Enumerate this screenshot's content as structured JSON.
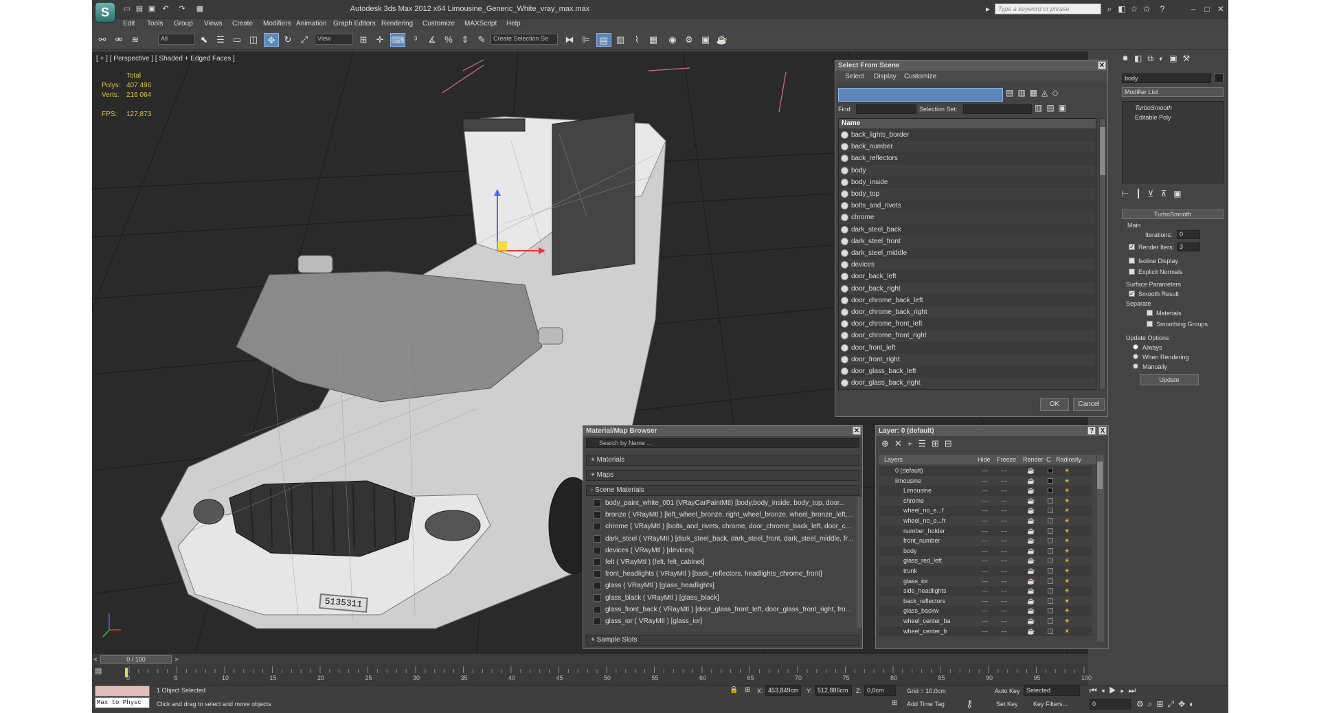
{
  "window": {
    "title": "Autodesk 3ds Max  2012 x64     Limousine_Generic_White_vray_max.max",
    "search_placeholder": "Type a keyword or phrase",
    "logo_glyph": "S"
  },
  "menu": [
    "Edit",
    "Tools",
    "Group",
    "Views",
    "Create",
    "Modifiers",
    "Animation",
    "Graph Editors",
    "Rendering",
    "Customize",
    "MAXScript",
    "Help"
  ],
  "toolbar": {
    "filter_value": "All",
    "refcoord_value": "View",
    "selection_set_placeholder": "Create Selection Se"
  },
  "viewport": {
    "label": "[ + ] [ Perspective ] [ Shaded + Edged Faces ]",
    "stats": {
      "total_label": "Total",
      "polys_label": "Polys:",
      "polys_value": "407 496",
      "verts_label": "Verts:",
      "verts_value": "216 064",
      "fps_label": "FPS:",
      "fps_value": "127,873"
    },
    "license_plate": "5135311"
  },
  "select_from_scene": {
    "title": "Select From Scene",
    "tabs": [
      "Select",
      "Display",
      "Customize"
    ],
    "find_label": "Find:",
    "selection_set_label": "Selection Set:",
    "column_name": "Name",
    "items": [
      "back_lights_border",
      "back_number",
      "back_reflectors",
      "body",
      "body_inside",
      "body_top",
      "bolts_and_rivets",
      "chrome",
      "dark_steel_back",
      "dark_steel_front",
      "dark_steel_middle",
      "devices",
      "door_back_left",
      "door_back_right",
      "door_chrome_back_left",
      "door_chrome_back_right",
      "door_chrome_front_left",
      "door_chrome_front_right",
      "door_front_left",
      "door_front_right",
      "door_glass_back_left",
      "door_glass_back_right"
    ],
    "ok_label": "OK",
    "cancel_label": "Cancel"
  },
  "material_browser": {
    "title": "Material/Map Browser",
    "search_placeholder": "Search by Name ...",
    "sections": {
      "materials": "+ Materials",
      "maps": "+ Maps",
      "scene": "- Scene Materials",
      "samples": "+ Sample Slots"
    },
    "items": [
      "body_paint_white_001 (VRayCarPaintMtl) [body,body_inside, body_top, door...",
      "bronze ( VRayMtl ) [left_wheel_bronze, right_wheel_bronze, wheel_bronze_left,...",
      "chrome ( VRayMtl ) [bolts_and_rivets, chrome, door_chrome_back_left, door_c...",
      "dark_steel ( VRayMtl ) [dark_steel_back, dark_steel_front, dark_steel_middle, fr...",
      "devices ( VRayMtl ) [devices]",
      "felt ( VRayMtl ) [felt, felt_cabinet]",
      "front_headlights ( VRayMtl ) [back_reflectors, headlights_chrome_front]",
      "glass ( VRayMtl ) [glass_headlights]",
      "glass_black ( VRayMtl ) [glass_black]",
      "glass_front_back ( VRayMtl ) [door_glass_front_left, door_glass_front_right, fro...",
      "glass_ior ( VRayMtl ) [glass_ior]"
    ]
  },
  "layer_manager": {
    "title": "Layer: 0 (default)",
    "columns": [
      "Layers",
      "Hide",
      "Freeze",
      "Render",
      "C",
      "Radiosity"
    ],
    "rows": [
      "0 (default)",
      "limousine",
      "Limousine",
      "chrome",
      "wheel_no_e...f",
      "wheel_no_e...fr",
      "number_holder",
      "front_number",
      "body",
      "glass_red_left",
      "trunk",
      "glass_ior",
      "side_headlights",
      "back_reflectors",
      "glass_backw",
      "wheel_center_ba",
      "wheel_center_fr"
    ],
    "help_label": "?",
    "close_label": "X"
  },
  "command_panel": {
    "object_name": "body",
    "modifier_list": "Modifier List",
    "stack": [
      "TurboSmooth",
      "Editable Poly"
    ],
    "rollout_title": "TurboSmooth",
    "main_label": "Main",
    "iterations_label": "Iterations:",
    "iterations_value": "0",
    "render_iters_label": "Render Iters:",
    "render_iters_value": "3",
    "isoline_label": "Isoline Display",
    "explicit_label": "Explicit Normals",
    "surface_label": "Surface Parameters",
    "smooth_result_label": "Smooth Result",
    "separate_label": "Separate",
    "materials_label": "Materials",
    "smoothing_groups_label": "Smoothing Groups",
    "update_options_label": "Update Options",
    "always_label": "Always",
    "when_rendering_label": "When Rendering",
    "manually_label": "Manually",
    "update_button": "Update"
  },
  "timeline": {
    "frame_display": "0 / 100",
    "ticks": [
      "0",
      "5",
      "10",
      "15",
      "20",
      "25",
      "30",
      "35",
      "40",
      "45",
      "50",
      "55",
      "60",
      "65",
      "70",
      "75",
      "80",
      "85",
      "90",
      "95",
      "100"
    ]
  },
  "status": {
    "maxscript_label": "Max to Physc",
    "selected_text": "1 Object Selected",
    "prompt_text": "Click and drag to select and move objects",
    "x_label": "X:",
    "x_value": "453,849cm",
    "y_label": "Y:",
    "y_value": "512,886cm",
    "z_label": "Z:",
    "z_value": "0,0cm",
    "grid_text": "Grid = 10,0cm",
    "add_time_tag": "Add Time Tag",
    "auto_key_label": "Auto Key",
    "set_key_label": "Set Key",
    "key_mode_value": "Selected",
    "key_filters_label": "Key Filters...",
    "frame_value": "0"
  }
}
